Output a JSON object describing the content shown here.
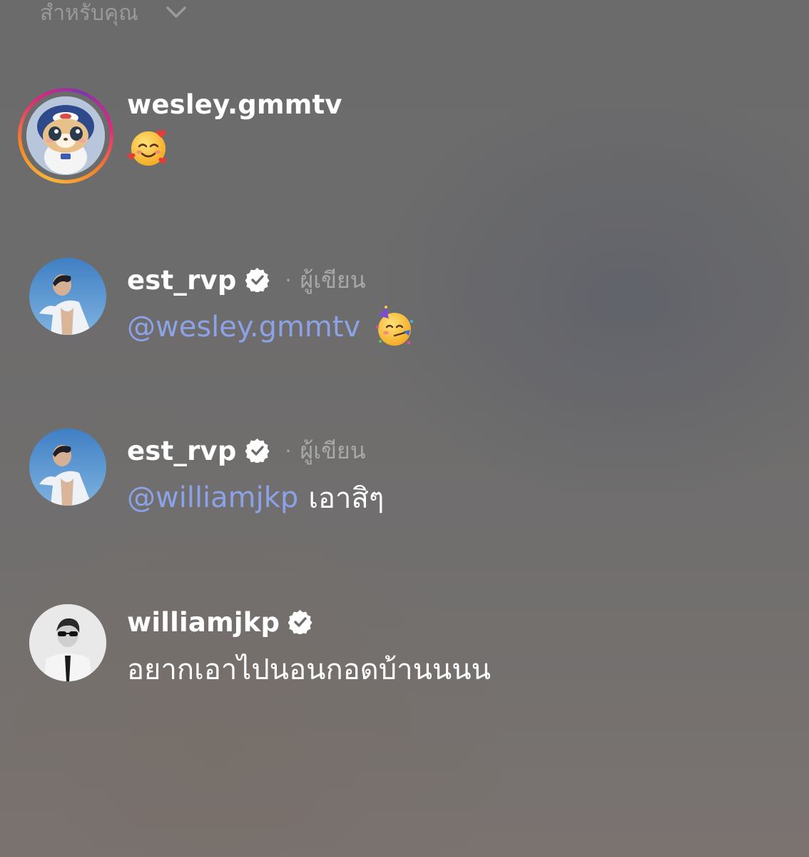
{
  "header": {
    "title": "สำหรับคุณ"
  },
  "comments": [
    {
      "username": "wesley.gmmtv",
      "verified": false,
      "has_story_ring": true,
      "emoji": "smiling-face-with-hearts"
    },
    {
      "username": "est_rvp",
      "verified": true,
      "author_tag": "ผู้เขียน",
      "mention": "@wesley.gmmtv",
      "emoji": "partying-face"
    },
    {
      "username": "est_rvp",
      "verified": true,
      "author_tag": "ผู้เขียน",
      "mention": "@williamjkp",
      "text": "เอาสิๆ"
    },
    {
      "username": "williamjkp",
      "verified": true,
      "text": "อยากเอาไปนอนกอดบ้านนนน"
    }
  ],
  "colors": {
    "mention": "#8ba3e6",
    "secondary_text": "#a8a8a8",
    "header_text": "#9a9a9a"
  }
}
